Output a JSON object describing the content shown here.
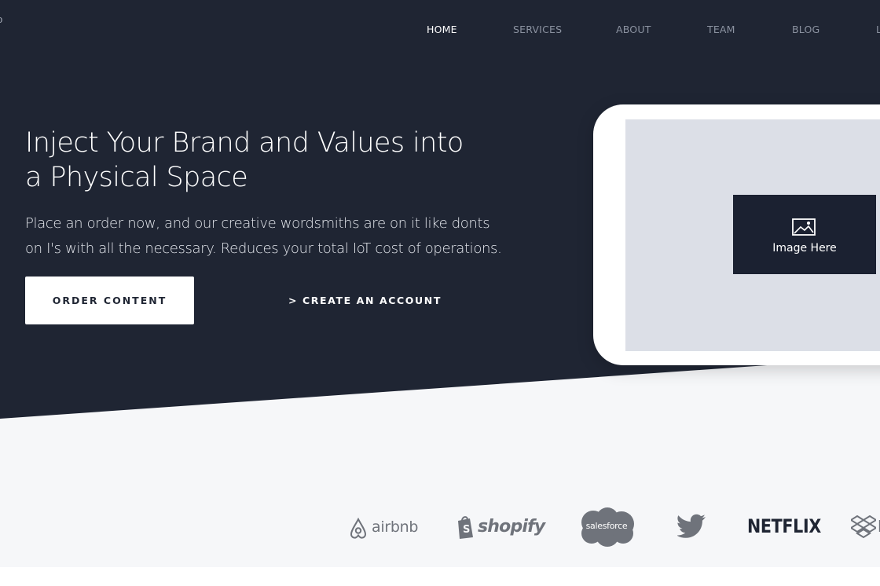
{
  "nav": {
    "corner_glyph": "o",
    "items": [
      {
        "label": "HOME",
        "active": true
      },
      {
        "label": "SERVICES",
        "active": false
      },
      {
        "label": "ABOUT",
        "active": false
      },
      {
        "label": "TEAM",
        "active": false
      },
      {
        "label": "BLOG",
        "active": false
      },
      {
        "label": "L",
        "active": false
      }
    ]
  },
  "hero": {
    "title_lines": [
      "Inject Your Brand and Values into",
      "a Physical Space"
    ],
    "subtitle_lines": [
      "Place an order now, and our creative wordsmiths are on it like donts",
      "on I's with all the necessary. Reduces your total IoT cost of operations."
    ],
    "primary_button": "ORDER CONTENT",
    "secondary_link": "> CREATE AN ACCOUNT"
  },
  "mockup": {
    "image_label": "Image Here",
    "icon": "image-icon"
  },
  "logos": {
    "airbnb": "airbnb",
    "shopify": "shopify",
    "salesforce": "salesforce",
    "twitter": "twitter-bird-icon",
    "netflix": "NETFLIX",
    "dropbox": "D"
  },
  "colors": {
    "hero_background": "#1f2533",
    "lower_background": "#f6f7f9",
    "nav_active": "#ffffff",
    "nav_inactive": "#8b92a0",
    "logo_gray": "#6f737b",
    "placeholder_dark": "#1b2131",
    "screen_gray": "#dcdfe7"
  }
}
